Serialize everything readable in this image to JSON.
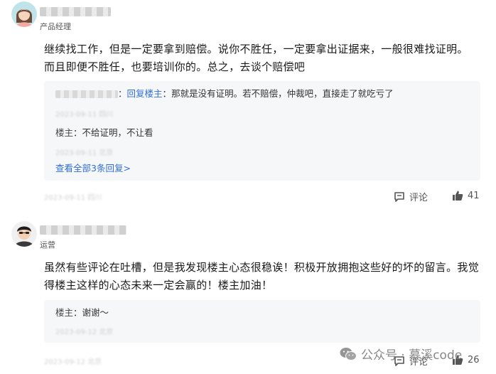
{
  "comments": [
    {
      "role": "产品经理",
      "text": "继续找工作，但是一定要拿到赔偿。说你不胜任，一定要拿出证据来，一般很难找证明。而且即便不胜任，也要培训你的。总之，去谈个赔偿吧",
      "replies": [
        {
          "name_suffix": "：",
          "reply_word": "回复",
          "reply_to": "楼主",
          "sep": "：",
          "text": "那就是没有证明。若不赔偿，仲裁吧，直接走了就吃亏了",
          "meta": "2023-09-11 四川"
        },
        {
          "name": "楼主",
          "sep": "：",
          "text": "不给证明，不让看",
          "meta": "2023-09-11 北京"
        }
      ],
      "see_all": "查看全部3条回复>",
      "meta": "2023-09-11 四川",
      "comment_label": "评论",
      "likes": "41"
    },
    {
      "role": "运营",
      "text": "虽然有些评论在吐槽，但是我发现楼主心态很稳诶！积极开放拥抱这些好的坏的留言。我觉得楼主这样的心态未来一定会赢的！楼主加油！",
      "replies": [
        {
          "name": "楼主",
          "sep": "：",
          "text": "谢谢～",
          "meta": "2023-09-12 北京"
        }
      ],
      "meta": "2023-09-12 北京",
      "comment_label": "评论",
      "likes": "26"
    }
  ],
  "watermark": "公众号 · 慕溪code",
  "colors": {
    "link": "#2f6ed8",
    "reply_bg": "#f6f7f9"
  },
  "icons": [
    "comment-icon",
    "thumbs-up-icon",
    "wechat-icon"
  ]
}
